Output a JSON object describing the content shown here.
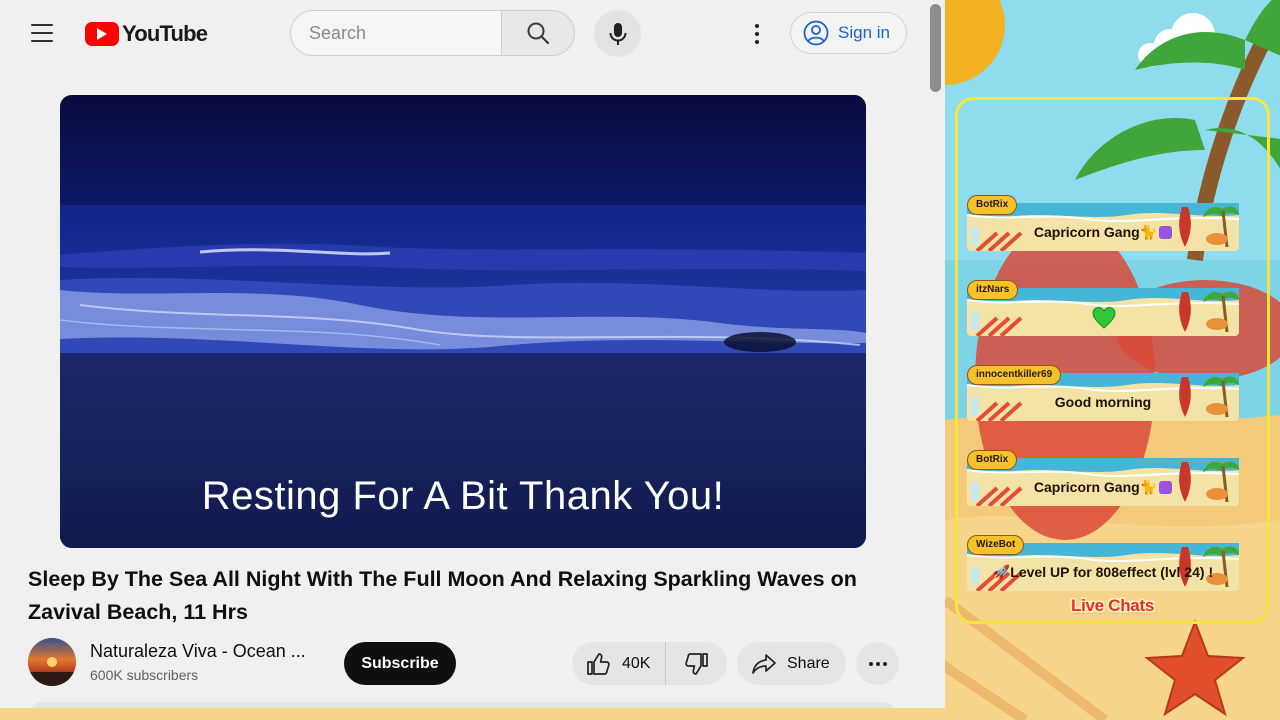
{
  "header": {
    "logo_text": "YouTube",
    "search_placeholder": "Search",
    "sign_in_label": "Sign in"
  },
  "video": {
    "overlay_text": "Resting For A Bit Thank You!",
    "title": "Sleep By The Sea All Night With The Full Moon And Relaxing Sparkling Waves on Zavival Beach, 11 Hrs"
  },
  "channel": {
    "name": "Naturaleza Viva - Ocean ...",
    "subscribers": "600K subscribers",
    "subscribe_label": "Subscribe"
  },
  "actions": {
    "like_count": "40K",
    "share_label": "Share"
  },
  "chat_overlay": {
    "footer": "Live Chats",
    "messages": [
      {
        "user": "BotRix",
        "text": "Capricorn Gang",
        "emotes": [
          "cat-emote",
          "capricorn-sign"
        ]
      },
      {
        "user": "itzNars",
        "text": "",
        "emotes": [
          "green-heart"
        ]
      },
      {
        "user": "innocentkiller69",
        "text": "Good morning",
        "emotes": []
      },
      {
        "user": "BotRix",
        "text": "Capricorn Gang",
        "emotes": [
          "cat-emote",
          "capricorn-sign"
        ]
      },
      {
        "user": "WizeBot",
        "text": "Level UP for 808effect (lvl 24) !",
        "emotes": [
          "rocket-emote"
        ]
      }
    ]
  },
  "colors": {
    "youtube_red": "#ff0000",
    "sign_in_blue": "#1964c8",
    "chat_frame": "#f5e63d",
    "live_chats_red": "#e5302a"
  }
}
